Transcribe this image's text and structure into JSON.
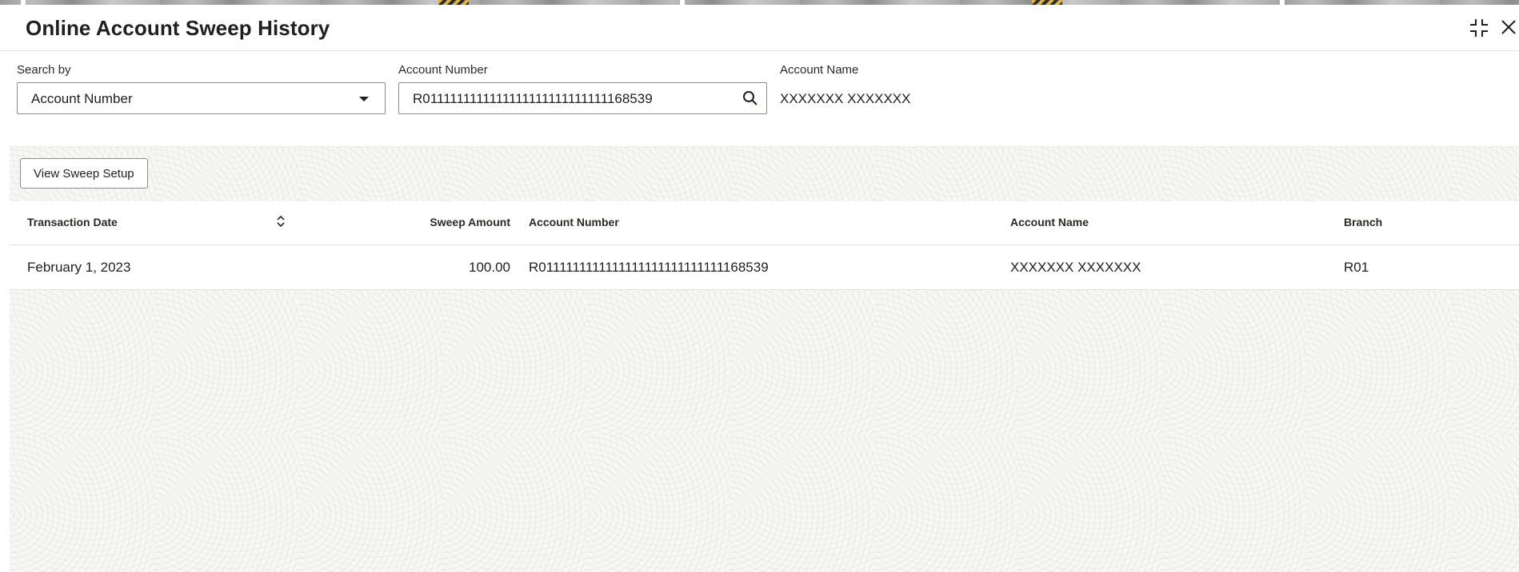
{
  "window": {
    "title": "Online Account Sweep History",
    "maximize_icon": "collapse-icon",
    "close_icon": "close-icon"
  },
  "search": {
    "search_by_label": "Search by",
    "search_by_value": "Account Number",
    "account_number_label": "Account Number",
    "account_number_value": "R0111111111111111111111111111168539",
    "account_name_label": "Account Name",
    "account_name_value": "XXXXXXX XXXXXXX"
  },
  "toolbar": {
    "view_sweep_setup_label": "View Sweep Setup"
  },
  "table": {
    "columns": {
      "transaction_date": "Transaction Date",
      "sweep_amount": "Sweep Amount",
      "account_number": "Account Number",
      "account_name": "Account Name",
      "branch": "Branch"
    },
    "rows": [
      {
        "transaction_date": "February 1, 2023",
        "sweep_amount": "100.00",
        "account_number": "R0111111111111111111111111111168539",
        "account_name": "XXXXXXX XXXXXXX",
        "branch": "R01"
      }
    ]
  }
}
